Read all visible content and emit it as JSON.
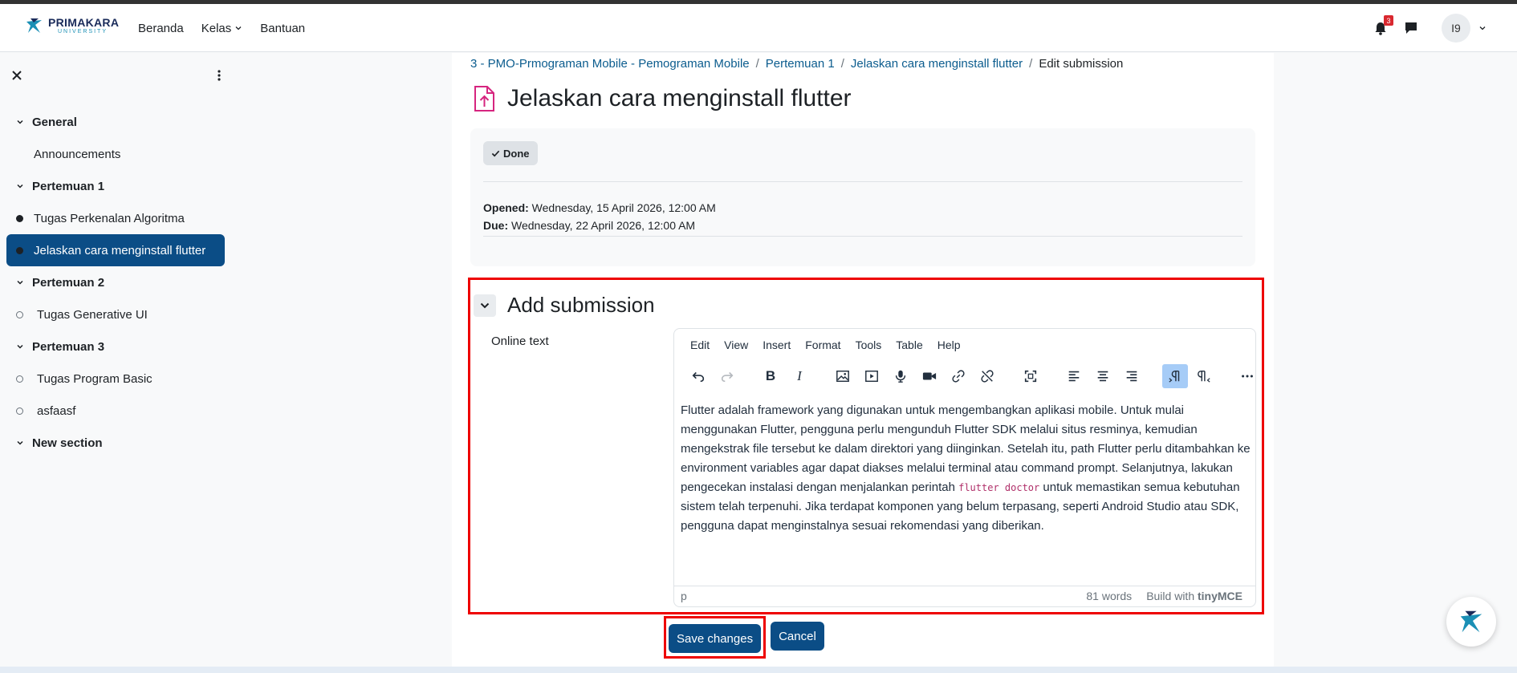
{
  "header": {
    "logo_name": "PRIMAKARA",
    "logo_sub": "UNIVERSITY",
    "nav": [
      "Beranda",
      "Kelas",
      "Bantuan"
    ],
    "notification_count": "3",
    "avatar_initials": "I9"
  },
  "sidebar": {
    "sections": [
      {
        "title": "General",
        "items": [
          {
            "label": "Announcements",
            "marker": "none"
          }
        ]
      },
      {
        "title": "Pertemuan 1",
        "items": [
          {
            "label": "Tugas Perkenalan Algoritma",
            "marker": "filled"
          },
          {
            "label": "Jelaskan cara menginstall flutter",
            "marker": "filled",
            "active": true
          }
        ]
      },
      {
        "title": "Pertemuan 2",
        "items": [
          {
            "label": "Tugas Generative UI",
            "marker": "hollow"
          }
        ]
      },
      {
        "title": "Pertemuan 3",
        "items": [
          {
            "label": "Tugas Program Basic",
            "marker": "hollow"
          },
          {
            "label": "asfaasf",
            "marker": "hollow"
          }
        ]
      },
      {
        "title": "New section",
        "items": []
      }
    ]
  },
  "breadcrumb": {
    "items": [
      "3 - PMO-Prmograman Mobile - Pemograman Mobile",
      "Pertemuan 1",
      "Jelaskan cara menginstall flutter"
    ],
    "current": "Edit submission"
  },
  "page": {
    "title": "Jelaskan cara menginstall flutter",
    "done_label": "Done",
    "opened_label": "Opened:",
    "opened_value": "Wednesday, 15 April 2026, 12:00 AM",
    "due_label": "Due:",
    "due_value": "Wednesday, 22 April 2026, 12:00 AM"
  },
  "submission": {
    "title": "Add submission",
    "online_text_label": "Online text",
    "menu": [
      "Edit",
      "View",
      "Insert",
      "Format",
      "Tools",
      "Table",
      "Help"
    ],
    "text_before_code": "Flutter adalah framework yang digunakan untuk mengembangkan aplikasi mobile. Untuk mulai menggunakan Flutter, pengguna perlu mengunduh Flutter SDK melalui situs resminya, kemudian mengekstrak file tersebut ke dalam direktori yang diinginkan. Setelah itu, path Flutter perlu ditambahkan ke environment variables agar dapat diakses melalui terminal atau command prompt. Selanjutnya, lakukan pengecekan instalasi dengan menjalankan perintah ",
    "code": "flutter doctor",
    "text_after_code": " untuk memastikan semua kebutuhan sistem telah terpenuhi. Jika terdapat komponen yang belum terpasang, seperti Android Studio atau SDK, pengguna dapat menginstalnya sesuai rekomendasi yang diberikan.",
    "status_element": "p",
    "word_count": "81 words",
    "build_with": "Build with",
    "brand": "tinyMCE"
  },
  "actions": {
    "save": "Save changes",
    "cancel": "Cancel"
  }
}
